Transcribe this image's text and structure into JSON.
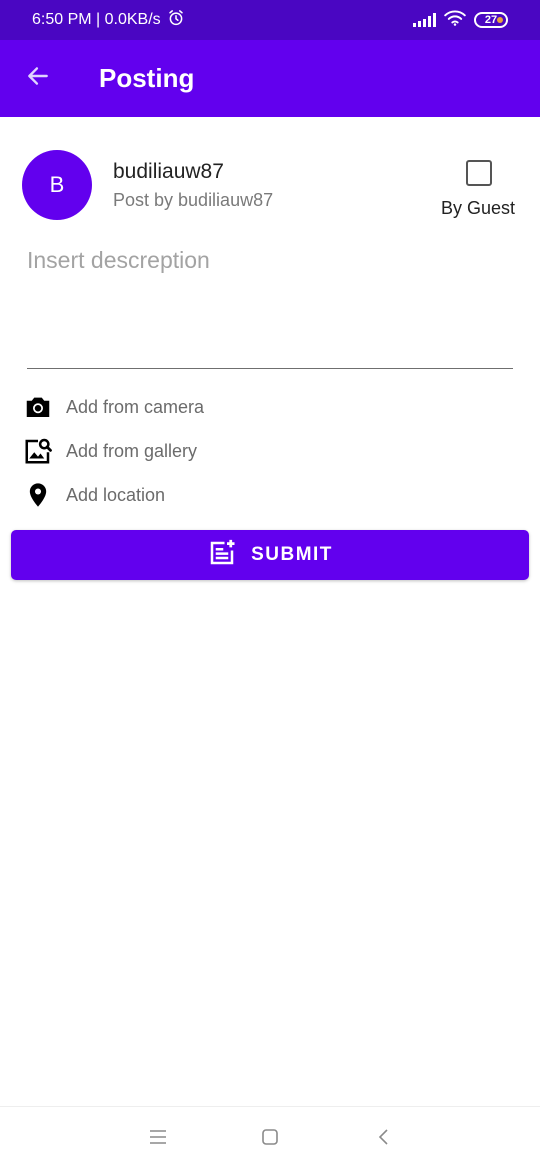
{
  "status_bar": {
    "time_speed": "6:50 PM | 0.0KB/s",
    "battery": "27",
    "icons": [
      "alarm-icon",
      "signal-icon",
      "wifi-icon",
      "battery-icon"
    ]
  },
  "app_bar": {
    "title": "Posting",
    "back_icon": "arrow-left-icon"
  },
  "user": {
    "avatar_letter": "B",
    "username": "budiliauw87",
    "post_by": "Post by budiliauw87"
  },
  "guest": {
    "label": "By Guest",
    "checked": false
  },
  "description": {
    "placeholder": "Insert descreption",
    "value": ""
  },
  "actions": {
    "camera": "Add from camera",
    "gallery": "Add from gallery",
    "location": "Add location"
  },
  "submit": {
    "label": "SUBMIT",
    "icon": "post-add-icon"
  },
  "navigation": {
    "icons": [
      "menu-icon",
      "home-icon",
      "back-icon"
    ]
  },
  "colors": {
    "status_bar": "#4a06c2",
    "primary": "#6200ee",
    "text": "#222222",
    "secondary_text": "#7a7a7a"
  }
}
